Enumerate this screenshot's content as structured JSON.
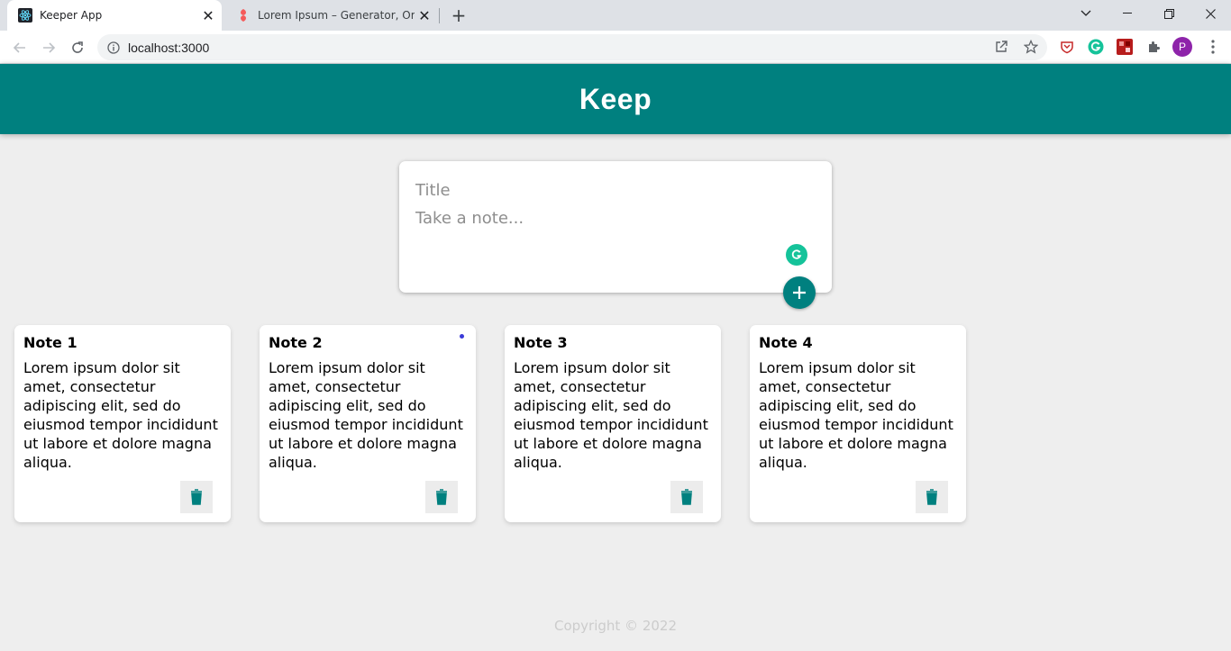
{
  "browser": {
    "tabs": [
      {
        "title": "Keeper App",
        "active": true
      },
      {
        "title": "Lorem Ipsum – Generator, Origins and Meaning",
        "active": false
      }
    ],
    "url": "localhost:3000",
    "profile_initial": "P"
  },
  "app": {
    "title": "Keep",
    "form": {
      "title_placeholder": "Title",
      "content_placeholder": "Take a note..."
    },
    "notes": [
      {
        "title": "Note 1",
        "content": "Lorem ipsum dolor sit amet, consectetur adipiscing elit, sed do eiusmod tempor incididunt ut labore et dolore magna aliqua."
      },
      {
        "title": "Note 2",
        "content": "Lorem ipsum dolor sit amet, consectetur adipiscing elit, sed do eiusmod tempor incididunt ut labore et dolore magna aliqua."
      },
      {
        "title": "Note 3",
        "content": "Lorem ipsum dolor sit amet, consectetur adipiscing elit, sed do eiusmod tempor incididunt ut labore et dolore magna aliqua."
      },
      {
        "title": "Note 4",
        "content": "Lorem ipsum dolor sit amet, consectetur adipiscing elit, sed do eiusmod tempor incididunt ut labore et dolore magna aliqua."
      }
    ],
    "footer": "Copyright © 2022"
  },
  "colors": {
    "accent": "#00807f",
    "background": "#eeeeee",
    "footer_text": "#cccccc"
  }
}
